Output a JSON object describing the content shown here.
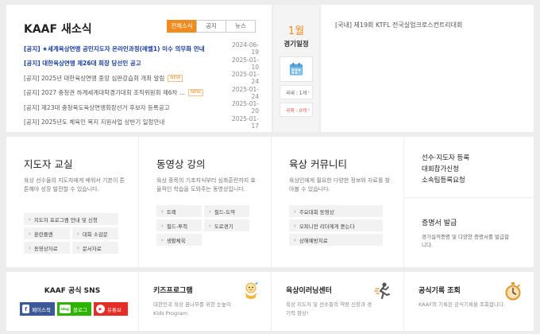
{
  "news": {
    "title": "KAAF 새소식",
    "tabs": [
      "전체소식",
      "공지",
      "뉴스"
    ],
    "new_label": "NEW",
    "items": [
      {
        "text": "[공지] ★세계육상연맹 공인지도자 온라인과정(레벨1) 이수 의무화 안내",
        "date": "2024-06-19",
        "highlight": true,
        "is_new": false
      },
      {
        "text": "[공지] 대한육상연맹 제26대 회장 당선인 공고",
        "date": "2025-01-10",
        "highlight": true,
        "is_new": false
      },
      {
        "text": "[공지] 2025년 대한육상연맹 중앙 심판강습회 개최 알림",
        "date": "2025-01-24",
        "highlight": false,
        "is_new": true
      },
      {
        "text": "[공지] 2027 충청권 하계세계대학경기대회 조직위원회 제6차 ...",
        "date": "2025-01-24",
        "highlight": false,
        "is_new": true
      },
      {
        "text": "[공지] 제23대 충청북도육상연맹회장선거 후보자 등록공고",
        "date": "2025-01-20",
        "highlight": false,
        "is_new": false
      },
      {
        "text": "[공지] 2025년도 체육인 복지 지원사업 상반기 일정안내",
        "date": "2025-01-17",
        "highlight": false,
        "is_new": false
      }
    ]
  },
  "calendar": {
    "month": "1월",
    "label": "경기일정",
    "domestic": "국내 : 1개",
    "international": "국외 : 0개"
  },
  "event": {
    "text": "[국내] 제19회 KTFL 전국실업크로스컨트리대회"
  },
  "teacher": {
    "title": "지도자 교실",
    "desc": "육상 선수들의 지도자에게 배워서 기본이 튼튼해야 성장 발전할 수 있습니다.",
    "buttons": [
      "지도자 프로그램 안내 및 신청",
      "훈련플랜",
      "대회 소감문",
      "동영상자료",
      "문서자료"
    ]
  },
  "video": {
    "title": "동영상 강의",
    "desc": "육상 종목의 기초지식부터 심화훈련까지 효율적인 학습을 도와주는 동영상입니다.",
    "buttons": [
      "트랙",
      "필드-도약",
      "필드-투척",
      "도로경기",
      "생활체육"
    ]
  },
  "community": {
    "title": "육상 커뮤니티",
    "desc": "육상인에게 필요한 다양한 정보와 자료를 찾아볼 수 있습니다.",
    "buttons": [
      "주요대회 동영상",
      "오피니언 리더에게 듣는다",
      "상해예방치료"
    ]
  },
  "side": {
    "links": [
      "선수·지도자 등록",
      "대회참가신청",
      "소속팀등록요청"
    ],
    "cert_title": "증명서 발급",
    "cert_desc": "경기실적증명 및 다양한 증명서를 발급합니다."
  },
  "sns": {
    "title": "KAAF 공식 SNS",
    "facebook": "페이스북",
    "blog_icon": "blog",
    "blog": "블로그",
    "youtube": "유튜브"
  },
  "kids": {
    "title": "키즈프로그램",
    "desc": "대한민국 육상 꿈나무를 위한 눈높이 Kids Program"
  },
  "learning": {
    "title": "육상이러닝센터",
    "desc": "육상 지도자 및 선수들의 역량 신장과 경기력 향상!"
  },
  "record": {
    "title": "공식기록 조회",
    "desc": "KAAF의 기록된 공식기록을 조회합니다."
  },
  "colors": {
    "accent": "#f08c1e",
    "highlight_text": "#1b3f9e",
    "facebook": "#3b5998",
    "blog": "#2db400",
    "youtube": "#e52d27"
  }
}
